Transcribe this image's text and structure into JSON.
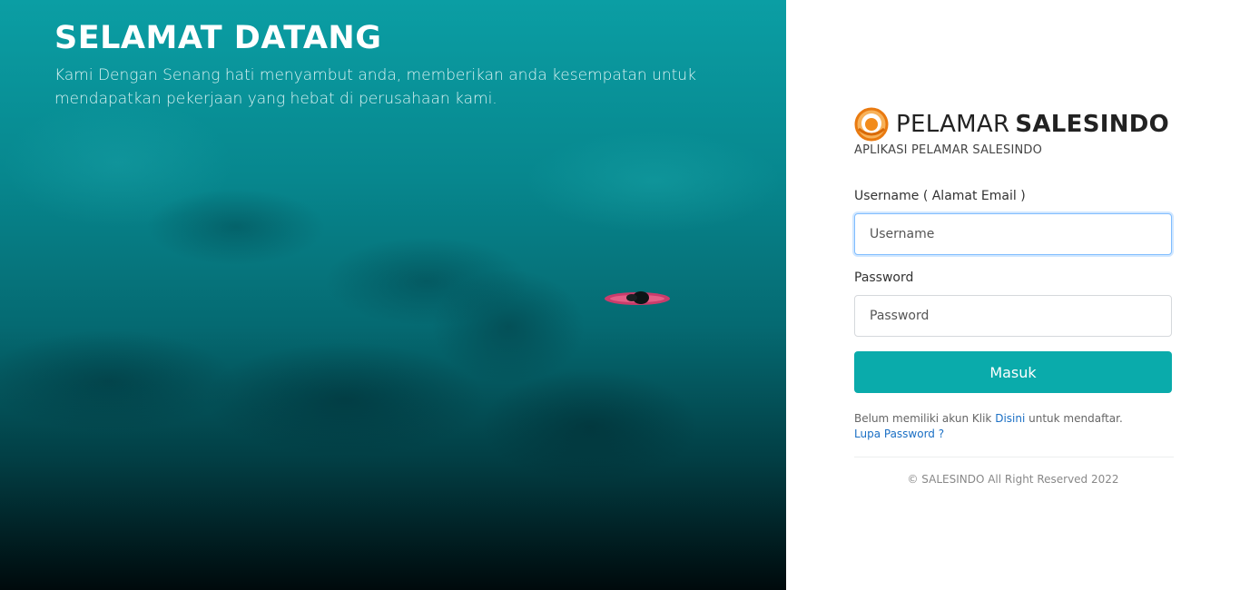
{
  "hero": {
    "title": "SELAMAT DATANG",
    "subtitle": "Kami Dengan Senang hati menyambut anda, memberikan anda kesempatan untuk mendapatkan pekerjaan yang hebat di perusahaan kami."
  },
  "brand": {
    "name_light": "PELAMAR",
    "name_bold": "SALESINDO",
    "tagline": "APLIKASI PELAMAR SALESINDO",
    "logo_icon": "orange-ring-logo-icon"
  },
  "form": {
    "username_label": "Username ( Alamat Email )",
    "username_placeholder": "Username",
    "password_label": "Password",
    "password_placeholder": "Password",
    "submit_label": "Masuk"
  },
  "links": {
    "register_prefix": "Belum memiliki akun Klik",
    "register_link": "Disini",
    "register_suffix": "untuk mendaftar.",
    "forgot_password": "Lupa Password ?"
  },
  "footer": {
    "copyright": "© SALESINDO All Right Reserved 2022"
  },
  "colors": {
    "accent": "#0aabab",
    "link": "#1a6fc4",
    "logo_orange": "#f28c1c"
  }
}
